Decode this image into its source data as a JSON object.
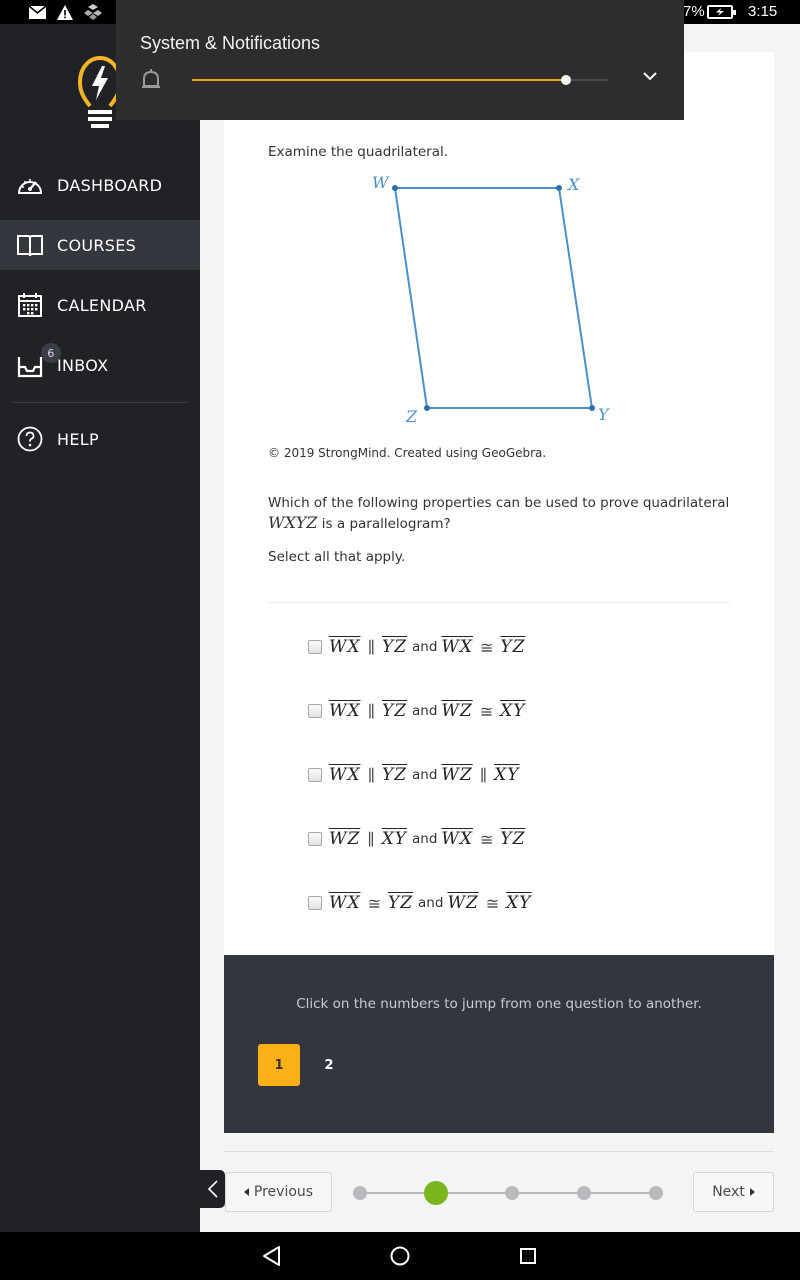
{
  "status_bar": {
    "left_icons": [
      "mail-icon",
      "warning-icon",
      "app-icon"
    ],
    "battery_text": "7%",
    "battery_icon": "battery-charging-icon",
    "time": "3:15"
  },
  "notification_panel": {
    "title": "System & Notifications",
    "bell_icon": "bell-icon",
    "volume_level_percent": 90,
    "expand_icon": "chevron-down-icon",
    "accent_color": "#f0a31c"
  },
  "sidebar": {
    "logo_icon": "lightbulb-bolt-icon",
    "items": [
      {
        "label": "DASHBOARD",
        "icon": "dashboard-gauge-icon",
        "active": false
      },
      {
        "label": "COURSES",
        "icon": "book-icon",
        "active": true
      },
      {
        "label": "CALENDAR",
        "icon": "calendar-icon",
        "active": false
      },
      {
        "label": "INBOX",
        "icon": "inbox-icon",
        "active": false,
        "badge": "6"
      },
      {
        "label": "HELP",
        "icon": "help-circle-icon",
        "active": false
      }
    ],
    "collapse_icon": "chevron-left-icon"
  },
  "content": {
    "intro": "Examine the quadrilateral.",
    "figure": {
      "vertices": [
        "W",
        "X",
        "Y",
        "Z"
      ],
      "color": "#4a90c8"
    },
    "credit": "© 2019 StrongMind. Created using GeoGebra.",
    "question_before": "Which of the following properties can be used to prove quadrilateral",
    "question_math": "WXYZ",
    "question_after": " is a parallelogram?",
    "instruction": "Select all that apply.",
    "choices": [
      {
        "checked": false,
        "a1": "WX",
        "op1": "∥",
        "b1": "YZ",
        "and": "and",
        "a2": "WX",
        "op2": "≅",
        "b2": "YZ"
      },
      {
        "checked": false,
        "a1": "WX",
        "op1": "∥",
        "b1": "YZ",
        "and": "and",
        "a2": "WZ",
        "op2": "≅",
        "b2": "XY"
      },
      {
        "checked": false,
        "a1": "WX",
        "op1": "∥",
        "b1": "YZ",
        "and": "and",
        "a2": "WZ",
        "op2": "∥",
        "b2": "XY"
      },
      {
        "checked": false,
        "a1": "WZ",
        "op1": "∥",
        "b1": "XY",
        "and": "and",
        "a2": "WX",
        "op2": "≅",
        "b2": "YZ"
      },
      {
        "checked": false,
        "a1": "WX",
        "op1": "≅",
        "b1": "YZ",
        "and": "and",
        "a2": "WZ",
        "op2": "≅",
        "b2": "XY"
      }
    ]
  },
  "question_nav": {
    "hint": "Click on the numbers to jump from one question to another.",
    "questions": [
      {
        "label": "1",
        "active": true
      },
      {
        "label": "2",
        "active": false
      }
    ],
    "active_color": "#fbb116"
  },
  "pager": {
    "previous_label": "Previous",
    "next_label": "Next",
    "steps_total": 5,
    "current_step": 2,
    "active_color": "#7ab51d",
    "inactive_color": "#b9babd"
  },
  "android_nav": {
    "back_icon": "back-triangle-icon",
    "home_icon": "home-circle-icon",
    "recents_icon": "recents-square-icon"
  }
}
